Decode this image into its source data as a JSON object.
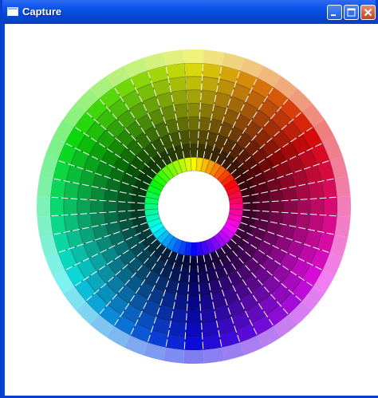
{
  "window": {
    "title": "Capture",
    "controls": {
      "minimize": "minimize-icon",
      "maximize": "maximize-icon",
      "close": "close-icon"
    },
    "colors": {
      "titlebar": "#0a53e8",
      "frame": "#0a3fd0",
      "client_background": "#ffffff"
    }
  },
  "color_wheel": {
    "segments": 48,
    "rings": 9,
    "hue_start_color": "#ffee00",
    "separator_color": "#ffffff"
  }
}
